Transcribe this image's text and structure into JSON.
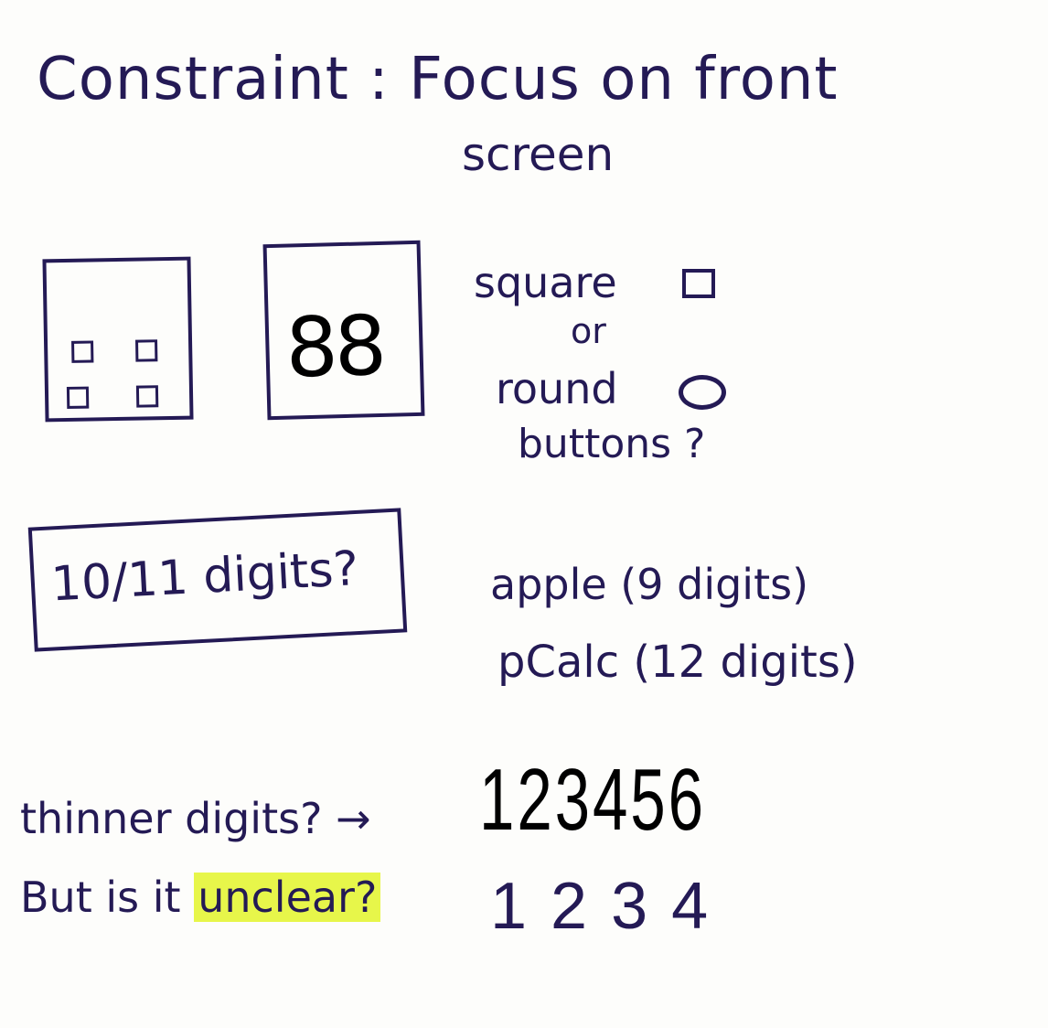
{
  "notes": {
    "title_line1": "Constraint : Focus on front",
    "title_line2": "screen",
    "mockup2_digits": "88",
    "button_question": {
      "line1": "square",
      "line2": "or",
      "line3": "round",
      "line4": "buttons ?"
    },
    "digits_box": "10/11 digits?",
    "apple_note": "apple (9 digits)",
    "pcalc_note": "pCalc (12 digits)",
    "thinner_note": "thinner digits? →",
    "thinner_sample": "123456",
    "unclear_prefix": "But is it ",
    "unclear_highlight": "unclear?",
    "normal_sample": "1234"
  },
  "colors": {
    "ink": "#241a55",
    "highlight": "#e7f64a",
    "paper": "#fdfdfb"
  }
}
